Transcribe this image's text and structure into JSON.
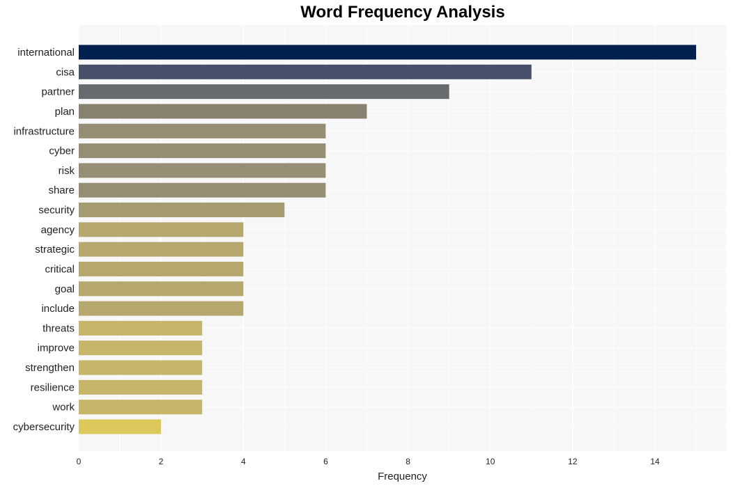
{
  "chart_data": {
    "type": "bar",
    "orientation": "horizontal",
    "title": "Word Frequency Analysis",
    "xlabel": "Frequency",
    "ylabel": "",
    "xlim": [
      0,
      15.7
    ],
    "xticks": [
      0,
      2,
      4,
      6,
      8,
      10,
      12,
      14
    ],
    "grid": true,
    "categories": [
      "international",
      "cisa",
      "partner",
      "plan",
      "infrastructure",
      "cyber",
      "risk",
      "share",
      "security",
      "agency",
      "strategic",
      "critical",
      "goal",
      "include",
      "threats",
      "improve",
      "strengthen",
      "resilience",
      "work",
      "cybersecurity"
    ],
    "values": [
      15,
      11,
      9,
      7,
      6,
      6,
      6,
      6,
      5,
      4,
      4,
      4,
      4,
      4,
      3,
      3,
      3,
      3,
      3,
      2
    ],
    "colors": [
      "#00204e",
      "#47506a",
      "#676a6f",
      "#86826f",
      "#958e74",
      "#958e74",
      "#958e74",
      "#958e74",
      "#a59b71",
      "#b6a76f",
      "#b6a76f",
      "#b6a76f",
      "#b6a76f",
      "#b6a76f",
      "#c7b56a",
      "#c7b56a",
      "#c7b56a",
      "#c7b56a",
      "#c7b56a",
      "#ddc85b"
    ]
  },
  "style": {
    "plot_background": "#f7f7f7",
    "grid_color": "#ffffff"
  }
}
